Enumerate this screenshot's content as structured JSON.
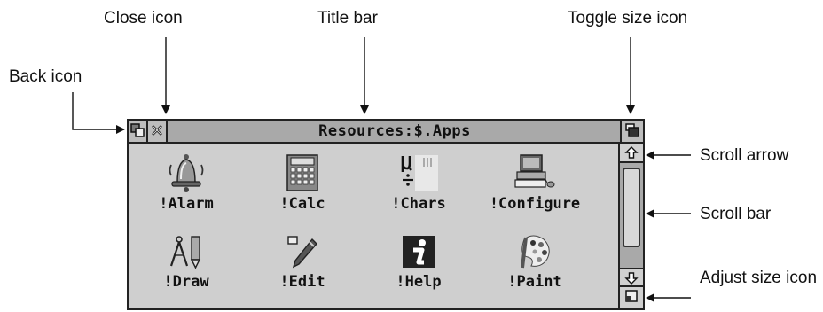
{
  "callouts": {
    "close_icon": "Close icon",
    "title_bar": "Title bar",
    "toggle_size_icon": "Toggle size icon",
    "back_icon": "Back icon",
    "scroll_arrow": "Scroll arrow",
    "scroll_bar": "Scroll bar",
    "adjust_size_icon": "Adjust size icon"
  },
  "window": {
    "title": "Resources:$.Apps",
    "apps": [
      {
        "label": "!Alarm",
        "icon": "alarm-bell-icon"
      },
      {
        "label": "!Calc",
        "icon": "calculator-icon"
      },
      {
        "label": "!Chars",
        "icon": "chars-icon"
      },
      {
        "label": "!Configure",
        "icon": "computer-icon"
      },
      {
        "label": "!Draw",
        "icon": "compass-pencil-icon"
      },
      {
        "label": "!Edit",
        "icon": "pen-icon"
      },
      {
        "label": "!Help",
        "icon": "info-icon"
      },
      {
        "label": "!Paint",
        "icon": "palette-icon"
      }
    ]
  },
  "colors": {
    "window_bg": "#cfcfcf",
    "titlebar_bg": "#a9a9a9",
    "border": "#222222"
  }
}
